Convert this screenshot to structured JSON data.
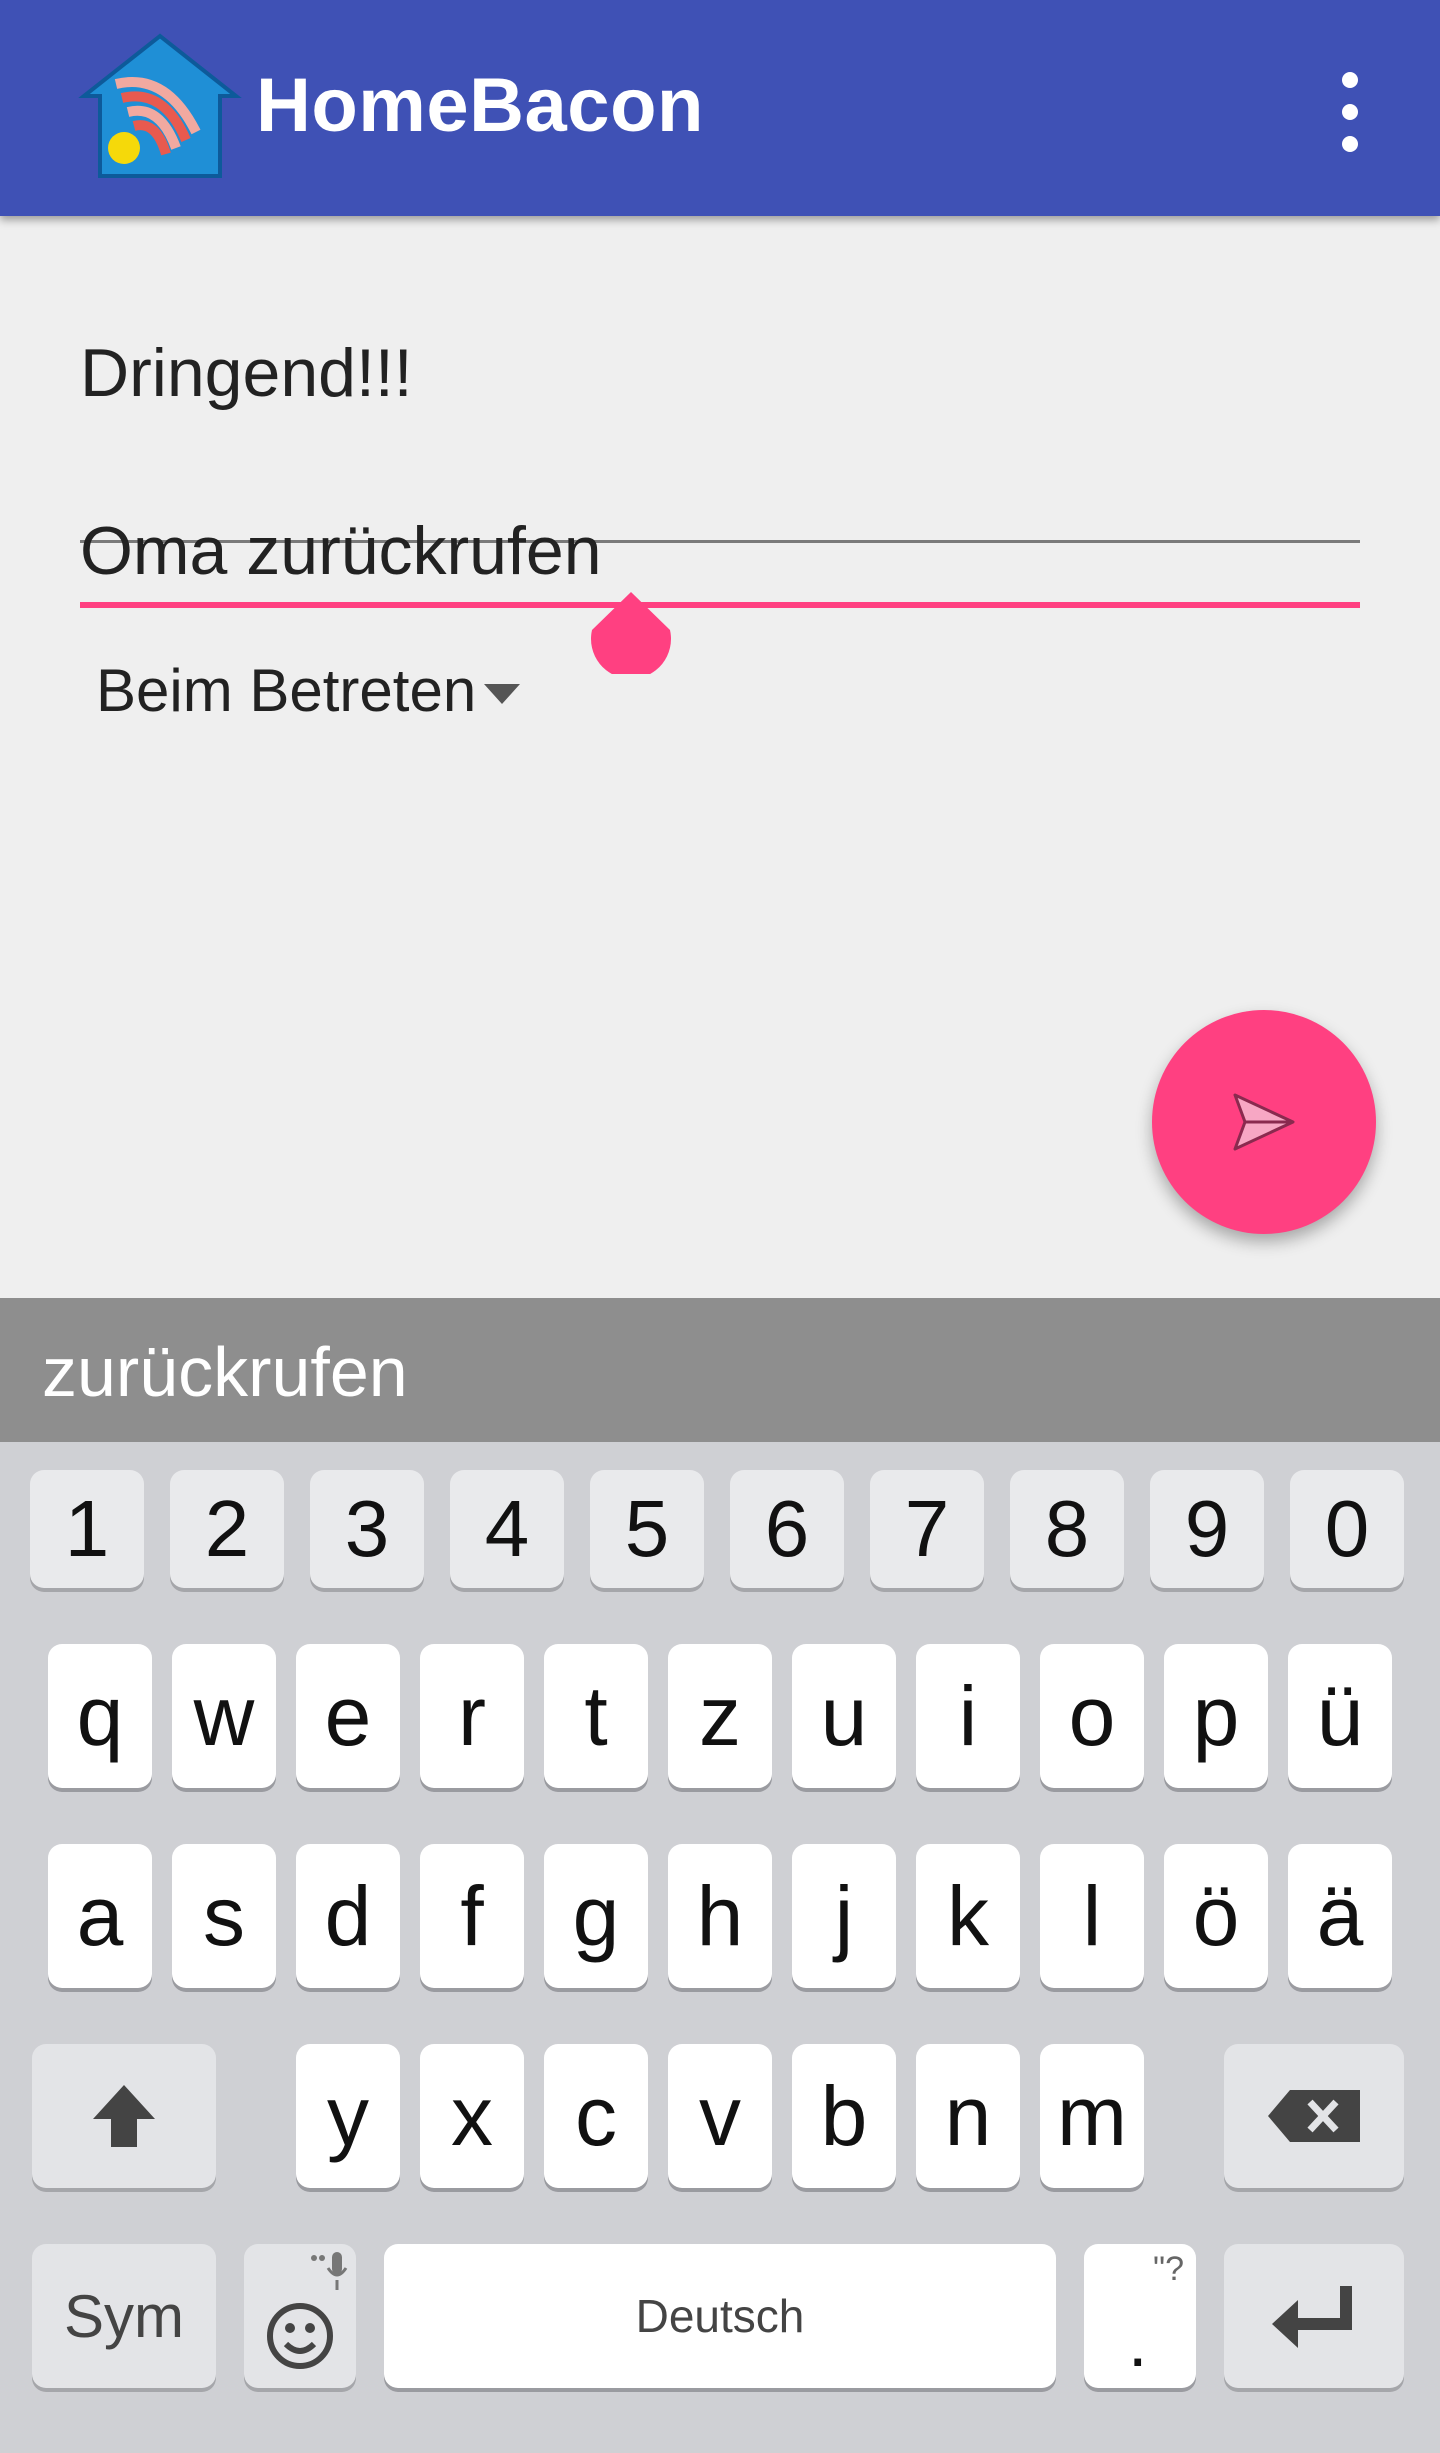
{
  "app_bar": {
    "title": "HomeBacon",
    "colors": {
      "background": "#3f51b5",
      "title": "#ffffff"
    },
    "icons": {
      "logo": "homebacon-logo",
      "menu": "more-vert-icon"
    }
  },
  "form": {
    "title_value": "Dringend!!!",
    "message_value": "Oma zurückrufen",
    "trigger_selected": "Beim Betreten",
    "accent_color": "#ff4081"
  },
  "fab": {
    "icon": "send-icon"
  },
  "keyboard": {
    "suggestion": "zurückrufen",
    "number_row": [
      "1",
      "2",
      "3",
      "4",
      "5",
      "6",
      "7",
      "8",
      "9",
      "0"
    ],
    "row1": [
      "q",
      "w",
      "e",
      "r",
      "t",
      "z",
      "u",
      "i",
      "o",
      "p",
      "ü"
    ],
    "row2": [
      "a",
      "s",
      "d",
      "f",
      "g",
      "h",
      "j",
      "k",
      "l",
      "ö",
      "ä"
    ],
    "row3": [
      "y",
      "x",
      "c",
      "v",
      "b",
      "n",
      "m"
    ],
    "sym_label": "Sym",
    "space_label": "Deutsch",
    "period_label": ".",
    "period_hint": "\"?",
    "icons": {
      "shift": "shift-icon",
      "backspace": "backspace-icon",
      "emoji": "emoji-icon",
      "mic": "mic-icon",
      "enter": "enter-icon"
    }
  }
}
